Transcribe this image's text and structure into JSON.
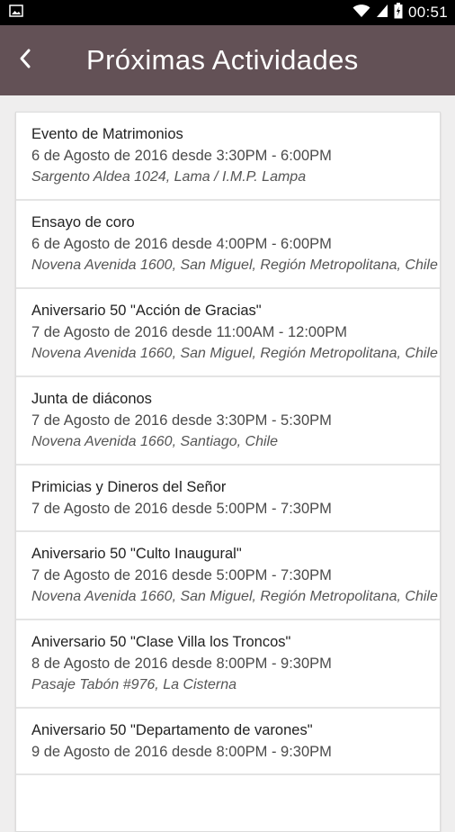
{
  "status_bar": {
    "time": "00:51",
    "icons": [
      "image-icon",
      "wifi-icon",
      "signal-icon",
      "battery-icon"
    ]
  },
  "app_bar": {
    "title": "Próximas Actividades",
    "back_icon": "chevron-left-icon",
    "color": "#635156"
  },
  "activities": [
    {
      "title": "Evento de Matrimonios",
      "time": "6 de Agosto de 2016 desde 3:30PM - 6:00PM",
      "place": "Sargento Aldea 1024, Lama / I.M.P. Lampa"
    },
    {
      "title": "Ensayo de coro",
      "time": "6 de Agosto de 2016 desde 4:00PM - 6:00PM",
      "place": "Novena Avenida 1600, San Miguel, Región Metropolitana, Chile"
    },
    {
      "title": "Aniversario 50 \"Acción de Gracias\"",
      "time": "7 de Agosto de 2016 desde 11:00AM - 12:00PM",
      "place": "Novena Avenida 1660, San Miguel, Región Metropolitana, Chile"
    },
    {
      "title": "Junta de diáconos",
      "time": "7 de Agosto de 2016 desde 3:30PM - 5:30PM",
      "place": "Novena Avenida 1660, Santiago, Chile"
    },
    {
      "title": "Primicias y Dineros del Señor",
      "time": "7 de Agosto de 2016 desde 5:00PM - 7:30PM",
      "place": ""
    },
    {
      "title": "Aniversario 50 \"Culto Inaugural\"",
      "time": "7 de Agosto de 2016 desde 5:00PM - 7:30PM",
      "place": "Novena Avenida 1660, San Miguel, Región Metropolitana, Chile"
    },
    {
      "title": "Aniversario 50 \"Clase Villa los Troncos\"",
      "time": "8 de Agosto de 2016 desde 8:00PM - 9:30PM",
      "place": "Pasaje Tabón #976, La Cisterna"
    },
    {
      "title": "Aniversario 50 \"Departamento de varones\"",
      "time": "9 de Agosto de 2016 desde 8:00PM - 9:30PM",
      "place": ""
    }
  ]
}
